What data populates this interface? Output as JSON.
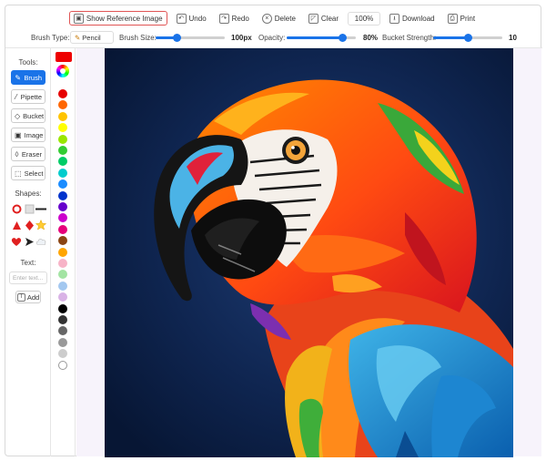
{
  "toolbar": {
    "show_reference": "Show Reference Image",
    "undo": "Undo",
    "redo": "Redo",
    "delete": "Delete",
    "clear": "Clear",
    "zoom": "100%",
    "download": "Download",
    "print": "Print"
  },
  "settings": {
    "brush_type_label": "Brush Type:",
    "brush_type_value": "Pencil",
    "brush_size_label": "Brush Size:",
    "brush_size_value": "100px",
    "brush_size_fraction": 0.3,
    "opacity_label": "Opacity:",
    "opacity_value": "80%",
    "opacity_fraction": 0.8,
    "bucket_label": "Bucket Strength:",
    "bucket_value": "10",
    "bucket_fraction": 0.5
  },
  "tools": {
    "title": "Tools:",
    "items": [
      {
        "label": "Brush",
        "icon": "brush-icon",
        "glyph": "✎",
        "active": true
      },
      {
        "label": "Pipette",
        "icon": "pipette-icon",
        "glyph": "⁄",
        "active": false
      },
      {
        "label": "Bucket",
        "icon": "bucket-icon",
        "glyph": "◇",
        "active": false
      },
      {
        "label": "Image",
        "icon": "image-icon",
        "glyph": "▣",
        "active": false
      },
      {
        "label": "Eraser",
        "icon": "eraser-icon",
        "glyph": "◊",
        "active": false
      },
      {
        "label": "Select",
        "icon": "select-icon",
        "glyph": "⬚",
        "active": false
      }
    ]
  },
  "shapes": {
    "title": "Shapes:",
    "items": [
      "circle",
      "square",
      "line",
      "triangle",
      "diamond",
      "star",
      "heart",
      "arrow",
      "cloud"
    ]
  },
  "text_tool": {
    "title": "Text:",
    "placeholder": "Enter text...",
    "add": "Add"
  },
  "palette": {
    "current": "#ee0000",
    "colors": [
      "#e60000",
      "#ff6600",
      "#ffc400",
      "#ffff00",
      "#99e600",
      "#33cc33",
      "#00cc66",
      "#00cccc",
      "#1a8cff",
      "#0033cc",
      "#6600cc",
      "#cc00cc",
      "#e6007a",
      "#8b4513",
      "#ffa500",
      "#f7b3c7",
      "#a3e4a3",
      "#a3c8f0",
      "#d9b3e6",
      "#000000",
      "#333333",
      "#666666",
      "#999999",
      "#cccccc",
      "#ffffff"
    ]
  }
}
